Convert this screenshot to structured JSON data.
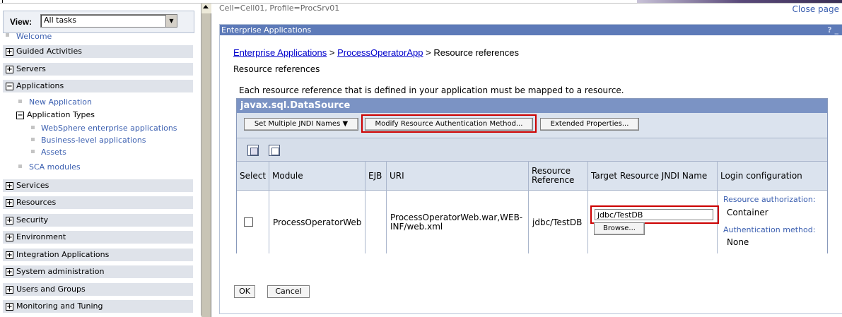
{
  "nav": {
    "view_label": "View:",
    "view_value": "All tasks",
    "welcome": "Welcome",
    "items": [
      {
        "label": "Guided Activities",
        "expanded": false
      },
      {
        "label": "Servers",
        "expanded": false
      },
      {
        "label": "Applications",
        "expanded": true
      },
      {
        "label": "Services",
        "expanded": false
      },
      {
        "label": "Resources",
        "expanded": false
      },
      {
        "label": "Security",
        "expanded": false
      },
      {
        "label": "Environment",
        "expanded": false
      },
      {
        "label": "Integration Applications",
        "expanded": false
      },
      {
        "label": "System administration",
        "expanded": false
      },
      {
        "label": "Users and Groups",
        "expanded": false
      },
      {
        "label": "Monitoring and Tuning",
        "expanded": false
      }
    ],
    "applications": {
      "new_application": "New Application",
      "application_types": "Application Types",
      "types": [
        "WebSphere enterprise applications",
        "Business-level applications",
        "Assets"
      ],
      "sca_modules": "SCA modules"
    }
  },
  "header": {
    "cell_profile": "Cell=Cell01, Profile=ProcSrv01",
    "close_page": "Close page"
  },
  "portlet": {
    "title": "Enterprise Applications",
    "help": "? _"
  },
  "breadcrumb": {
    "link1": "Enterprise Applications",
    "sep1": " > ",
    "link2": "ProcessOperatorApp",
    "sep2": " > ",
    "current": "Resource references"
  },
  "page_subtitle": "Resource references",
  "description": "Each resource reference that is defined in your application must be mapped to a resource.",
  "table": {
    "title": "javax.sql.DataSource",
    "buttons": {
      "set_jndi": "Set Multiple JNDI Names",
      "modify_auth": "Modify Resource Authentication Method...",
      "extended": "Extended Properties..."
    },
    "columns": [
      "Select",
      "Module",
      "EJB",
      "URI",
      "Resource Reference",
      "Target Resource JNDI Name",
      "Login configuration"
    ],
    "row": {
      "module": "ProcessOperatorWeb",
      "ejb": "",
      "uri": "ProcessOperatorWeb.war,WEB-INF/web.xml",
      "resource_reference": "jdbc/TestDB",
      "jndi_value": "jdbc/TestDB",
      "browse": "Browse...",
      "login": {
        "auth_label": "Resource authorization:",
        "auth_value": "Container",
        "method_label": "Authentication method:",
        "method_value": "None"
      }
    }
  },
  "footer": {
    "ok": "OK",
    "cancel": "Cancel"
  },
  "colors": {
    "title_bar": "#5d7ab8",
    "table_header": "#7b93c4",
    "highlight": "#cc0000",
    "link": "#0000cc"
  }
}
